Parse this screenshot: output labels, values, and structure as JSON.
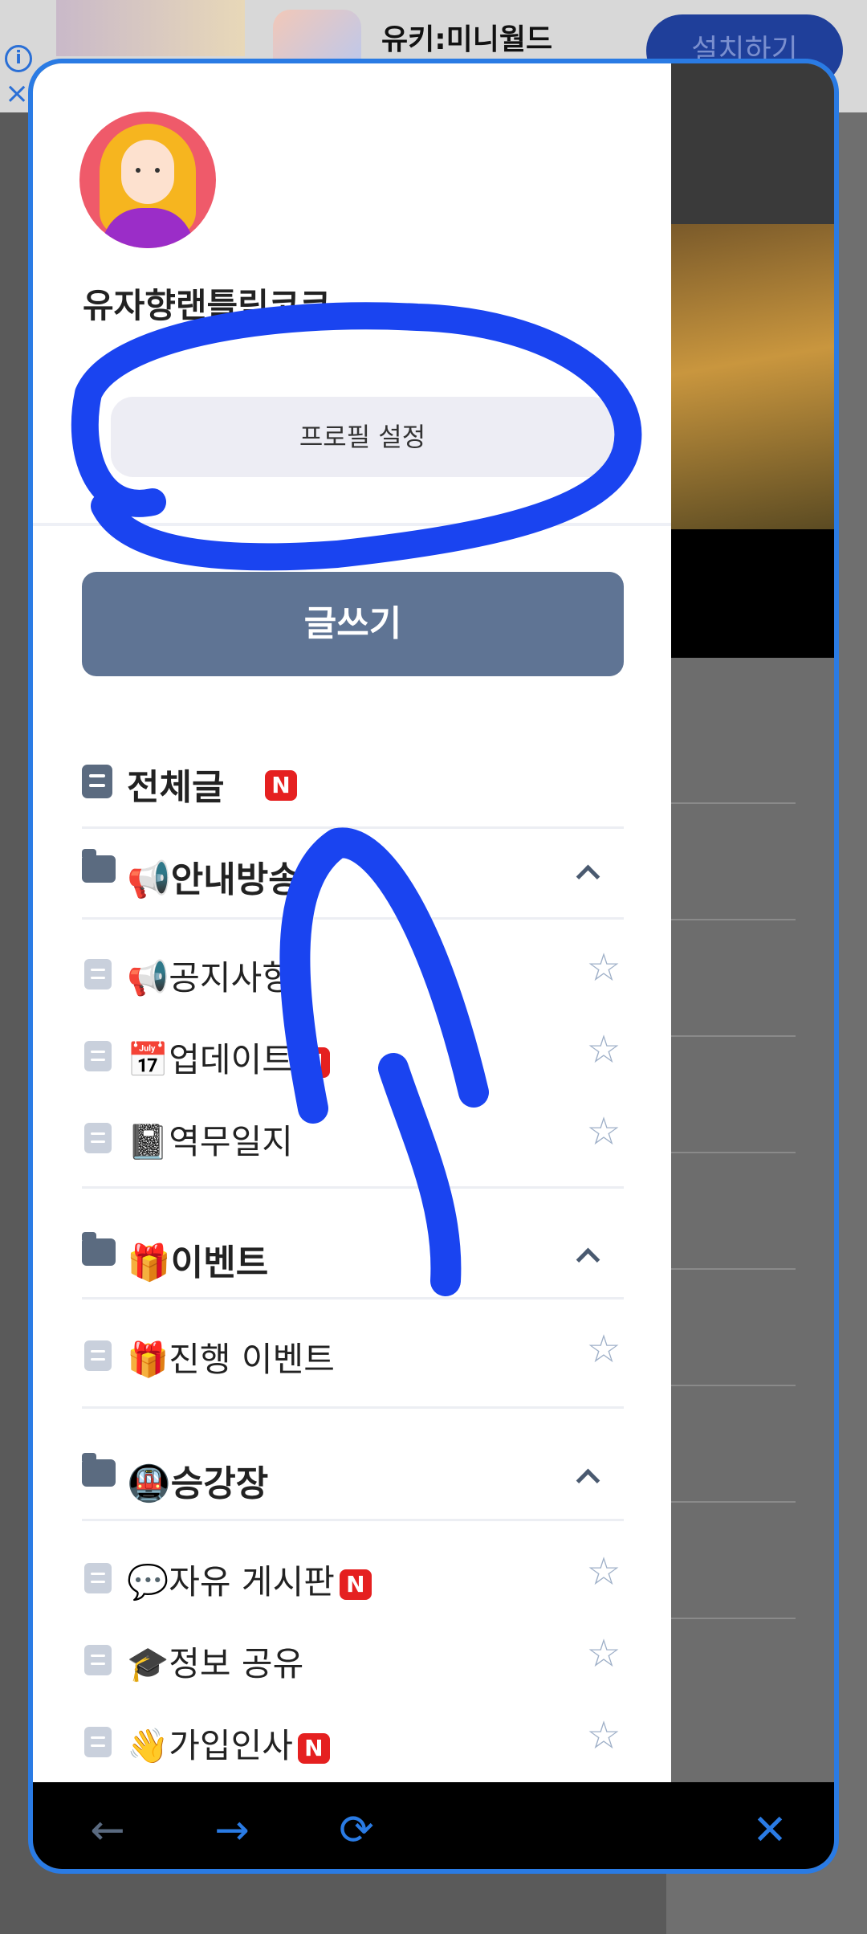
{
  "background": {
    "ad_title": "유키:미니월드",
    "install_label": "설치하기"
  },
  "profile": {
    "username": "유자향랜틀릭코코",
    "settings_label": "프로필 설정"
  },
  "write_label": "글쓰기",
  "all_posts": {
    "label": "전체글",
    "badge": "N"
  },
  "categories": [
    {
      "label": "📢안내방송",
      "items": [
        {
          "label": "📢공지사항",
          "badge": ""
        },
        {
          "label": "📅업데이트",
          "badge": "N"
        },
        {
          "label": "📓역무일지",
          "badge": ""
        }
      ]
    },
    {
      "label": "🎁이벤트",
      "items": [
        {
          "label": "🎁진행 이벤트",
          "badge": ""
        }
      ]
    },
    {
      "label": "🚇승강장",
      "items": [
        {
          "label": "💬자유 게시판",
          "badge": "N"
        },
        {
          "label": "🎓정보 공유",
          "badge": ""
        },
        {
          "label": "👋가입인사",
          "badge": "N"
        }
      ]
    }
  ],
  "navbar": {
    "back": "←",
    "forward": "→",
    "reload": "⟳",
    "close": "✕"
  },
  "colors": {
    "accent": "#2a7be4",
    "write_button": "#5f7494",
    "new_badge": "#e52020",
    "annotation": "#1a44f0"
  }
}
